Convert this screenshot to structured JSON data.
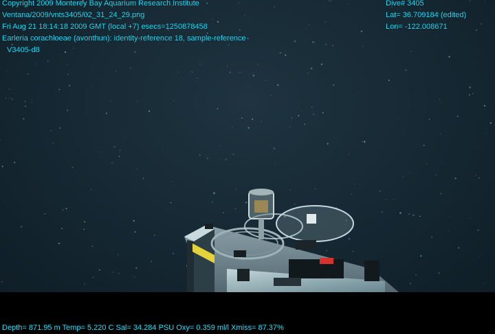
{
  "overlay": {
    "copyright": "Copyright 2009 Monterey Bay Aquarium Research Institute",
    "file_path": "Ventana/2009/vnts3405/02_31_24_29.png",
    "datetime": "Fri Aug 21 18:14:18 2009 GMT (local +7)  esecs=1250878458",
    "annotation": "Earleria corachloeae (avonthun): identity-reference 18, sample-reference",
    "dive_code": "V3405-d8",
    "dive": "Dive# 3405",
    "lat": "Lat= 36.709184 (edited)",
    "lon": "Lon= -122.008671",
    "telemetry": "Depth= 871.95 m  Temp= 5.220 C  Sal= 34.284 PSU  Oxy= 0.359 ml/l  Xmiss= 87.37%"
  },
  "colors": {
    "overlay_text": "#19e3ff",
    "water": "#172a35"
  }
}
